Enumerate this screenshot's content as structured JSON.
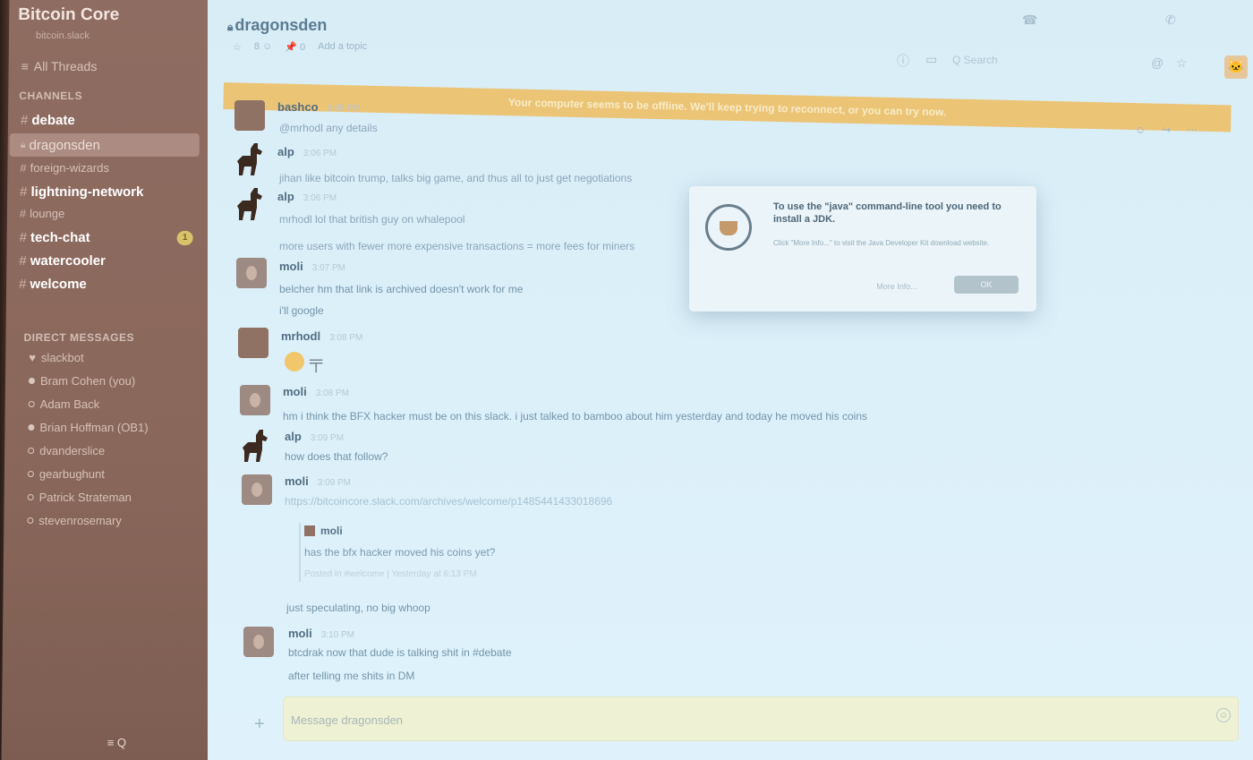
{
  "sidebar": {
    "team_name": "Bitcoin Core",
    "team_sub": "bitcoin.slack",
    "all_threads": "All Threads",
    "channels_label": "CHANNELS",
    "channels": [
      {
        "name": "debate"
      },
      {
        "name": "dragonsden"
      },
      {
        "name": "foreign-wizards"
      },
      {
        "name": "lightning-network"
      },
      {
        "name": "lounge"
      },
      {
        "name": "tech-chat"
      },
      {
        "name": "watercooler"
      },
      {
        "name": "welcome"
      }
    ],
    "badge": "1",
    "dm_label": "DIRECT MESSAGES",
    "dms": [
      {
        "name": "slackbot"
      },
      {
        "name": "Bram Cohen (you)"
      },
      {
        "name": "Adam Back"
      },
      {
        "name": "Brian Hoffman (OB1)"
      },
      {
        "name": "dvanderslice"
      },
      {
        "name": "gearbughunt"
      },
      {
        "name": "Patrick Strateman"
      },
      {
        "name": "stevenrosemary"
      }
    ],
    "footer": "≡ Q"
  },
  "header": {
    "channel_title": "dragonsden",
    "meta": [
      "☆",
      "8 ☺",
      "📌 0",
      "Add a topic"
    ],
    "search_placeholder": "Q Search",
    "banner": "Your computer seems to be offline. We'll keep trying to reconnect, or you can try now."
  },
  "messages": [
    {
      "author": "bashco",
      "time": "3:05 PM",
      "lines": [
        "@mrhodl any details"
      ]
    },
    {
      "author": "alp",
      "time": "3:06 PM",
      "lines": [
        "jihan like bitcoin trump, talks big game, and thus all to just get negotiations"
      ]
    },
    {
      "author": "alp",
      "time": "3:06 PM",
      "lines": [
        "mrhodl lol that british guy on whalepool",
        "more users with fewer more expensive transactions = more fees for miners"
      ]
    },
    {
      "author": "moli",
      "time": "3:07 PM",
      "lines": [
        "belcher hm that link is archived doesn't work for me",
        "i'll google"
      ]
    },
    {
      "author": "mrhodl",
      "time": "3:08 PM",
      "lines": []
    },
    {
      "author": "moli",
      "time": "3:08 PM",
      "lines": [
        "hm i think the BFX hacker must be on this slack. i just talked to bamboo about him yesterday and today he moved his coins"
      ]
    },
    {
      "author": "alp",
      "time": "3:09 PM",
      "lines": [
        "how does that follow?"
      ]
    },
    {
      "author": "moli",
      "time": "3:09 PM",
      "lines": [
        "https://bitcoincore.slack.com/archives/welcome/p1485441433018696"
      ]
    },
    {
      "author": "moli",
      "time": "3:10 PM",
      "lines": [
        "btcdrak now that dude is talking shit in #debate",
        "after telling me shits in DM"
      ]
    }
  ],
  "quote": {
    "author": "moli",
    "text": "has the bfx hacker moved his coins yet?",
    "meta": "Posted in #welcome | Yesterday at 6:13 PM"
  },
  "after_quote": "just speculating, no big whoop",
  "dialog": {
    "title": "To use the \"java\" command-line tool you need to install a JDK.",
    "body": "Click \"More Info...\" to visit the Java Developer Kit download website.",
    "more_info": "More Info...",
    "ok": "OK"
  },
  "composer": {
    "placeholder": "Message dragonsden"
  },
  "colors": {
    "sidebar": "#8f6c61",
    "main_bg": "#dcf0fa",
    "banner": "#ecc476"
  }
}
